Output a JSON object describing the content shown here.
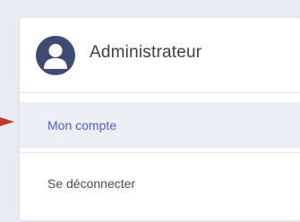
{
  "user": {
    "name": "Administrateur",
    "avatar_icon": "user-avatar-icon",
    "avatar_color": "#3f4b73"
  },
  "menu": {
    "items": [
      {
        "label": "Mon compte",
        "active": true,
        "color": "#5560c5"
      },
      {
        "label": "Se déconnecter",
        "active": false,
        "color": "#4a4d57"
      }
    ]
  },
  "pointer": {
    "icon": "red-arrow-icon",
    "color": "#c0392b"
  }
}
